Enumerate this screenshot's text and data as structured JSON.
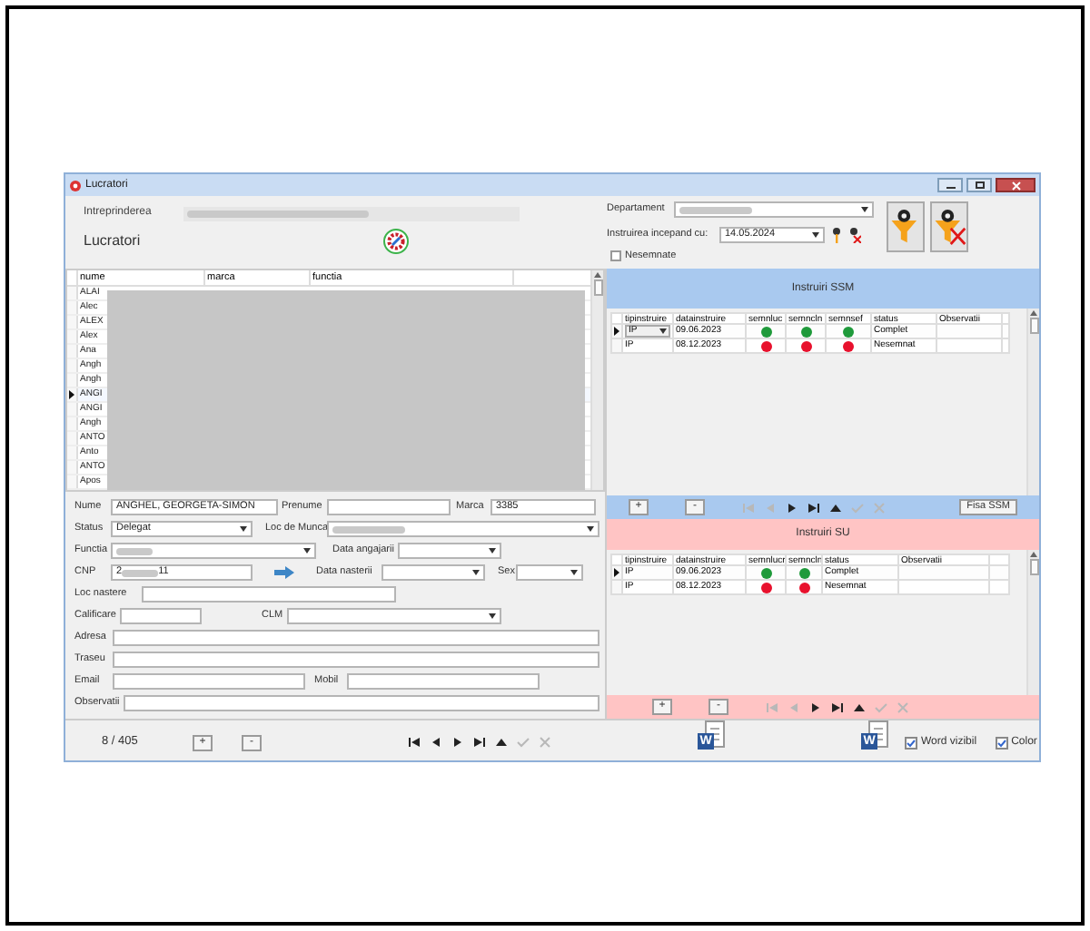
{
  "window": {
    "title": "Lucratori"
  },
  "header": {
    "intreprinderea_label": "Intreprinderea",
    "section_title": "Lucratori",
    "departament_label": "Departament",
    "instruirea_label": "Instruirea incepand cu:",
    "instruirea_value": "14.05.2024",
    "nesemnate": {
      "label": "Nesemnate",
      "checked": false
    }
  },
  "employees": {
    "columns": [
      "nume",
      "marca",
      "functia"
    ],
    "rows": [
      {
        "nume": "ALAI",
        "selected": false
      },
      {
        "nume": "Alec",
        "selected": false
      },
      {
        "nume": "ALEX",
        "selected": false
      },
      {
        "nume": "Alex",
        "selected": false
      },
      {
        "nume": "Ana",
        "selected": false
      },
      {
        "nume": "Angh",
        "selected": false
      },
      {
        "nume": "Angh",
        "selected": false
      },
      {
        "nume": "ANGI",
        "selected": true
      },
      {
        "nume": "ANGI",
        "selected": false
      },
      {
        "nume": "Angh",
        "selected": false
      },
      {
        "nume": "ANTO",
        "selected": false
      },
      {
        "nume": "Anto",
        "selected": false
      },
      {
        "nume": "ANTO",
        "selected": false
      },
      {
        "nume": "Apos",
        "selected": false
      }
    ]
  },
  "form": {
    "nume": {
      "label": "Nume",
      "value": "ANGHEL, GEORGETA-SIMON"
    },
    "prenume": {
      "label": "Prenume"
    },
    "marca": {
      "label": "Marca",
      "value": "3385"
    },
    "status": {
      "label": "Status",
      "value": "Delegat"
    },
    "loc_munca": {
      "label": "Loc de Munca"
    },
    "functia": {
      "label": "Functia"
    },
    "data_angajarii": {
      "label": "Data angajarii"
    },
    "cnp": {
      "label": "CNP",
      "value_start": "2",
      "value_end": "11"
    },
    "data_nasterii": {
      "label": "Data nasterii"
    },
    "sex": {
      "label": "Sex"
    },
    "loc_nastere": {
      "label": "Loc nastere"
    },
    "calificare": {
      "label": "Calificare"
    },
    "clm": {
      "label": "CLM"
    },
    "adresa": {
      "label": "Adresa"
    },
    "traseu": {
      "label": "Traseu"
    },
    "email": {
      "label": "Email"
    },
    "mobil": {
      "label": "Mobil"
    },
    "observatii": {
      "label": "Observatii"
    }
  },
  "ssm": {
    "title": "Instruiri SSM",
    "columns": [
      "tipinstruire",
      "datainstruire",
      "semnluc",
      "semncln",
      "semnsef",
      "status",
      "Observatii"
    ],
    "rows": [
      {
        "tipinstruire": "IP",
        "editing": true,
        "datainstruire": "09.06.2023",
        "marks": [
          {
            "color": "#1f9a3b"
          },
          {
            "color": "#1f9a3b"
          },
          {
            "color": "#1f9a3b"
          }
        ],
        "status": "Complet",
        "selected": true
      },
      {
        "tipinstruire": "IP",
        "editing": false,
        "datainstruire": "08.12.2023",
        "marks": [
          {
            "color": "#e8112d"
          },
          {
            "color": "#e8112d"
          },
          {
            "color": "#e8112d"
          }
        ],
        "status": "Nesemnat",
        "selected": false
      }
    ],
    "add_label": "+",
    "remove_label": "-",
    "nav": [
      {
        "kind": "first",
        "disabled": true
      },
      {
        "kind": "prev",
        "disabled": true
      },
      {
        "kind": "next",
        "disabled": false
      },
      {
        "kind": "last",
        "disabled": false
      },
      {
        "kind": "up",
        "disabled": false
      },
      {
        "kind": "post",
        "disabled": true
      },
      {
        "kind": "cancel",
        "disabled": true
      }
    ],
    "fisa_button": "Fisa SSM"
  },
  "su": {
    "title": "Instruiri SU",
    "columns": [
      "tipinstruire",
      "datainstruire",
      "semnlucr",
      "semncln",
      "status",
      "Observatii"
    ],
    "rows": [
      {
        "tipinstruire": "IP",
        "editing": false,
        "datainstruire": "09.06.2023",
        "marks": [
          {
            "color": "#1f9a3b"
          },
          {
            "color": "#1f9a3b"
          }
        ],
        "status": "Complet",
        "selected": true
      },
      {
        "tipinstruire": "IP",
        "editing": false,
        "datainstruire": "08.12.2023",
        "marks": [
          {
            "color": "#e8112d"
          },
          {
            "color": "#e8112d"
          }
        ],
        "status": "Nesemnat",
        "selected": false
      }
    ],
    "add_label": "+",
    "remove_label": "-",
    "nav": [
      {
        "kind": "first",
        "disabled": true
      },
      {
        "kind": "prev",
        "disabled": true
      },
      {
        "kind": "next",
        "disabled": false
      },
      {
        "kind": "last",
        "disabled": false
      },
      {
        "kind": "up",
        "disabled": false
      },
      {
        "kind": "post",
        "disabled": true
      },
      {
        "kind": "cancel",
        "disabled": true
      }
    ]
  },
  "footer": {
    "counter": "8 / 405",
    "add_label": "+",
    "remove_label": "-",
    "nav": [
      {
        "kind": "first",
        "disabled": false
      },
      {
        "kind": "prev",
        "disabled": false
      },
      {
        "kind": "next",
        "disabled": false
      },
      {
        "kind": "last",
        "disabled": false
      },
      {
        "kind": "up",
        "disabled": false
      },
      {
        "kind": "post",
        "disabled": true
      },
      {
        "kind": "cancel",
        "disabled": true
      }
    ],
    "word_buttons": [
      {
        "letter": "W"
      },
      {
        "letter": "W"
      }
    ],
    "word_vizibil": {
      "label": "Word vizibil",
      "checked": true
    },
    "color": {
      "label": "Color",
      "checked": true
    }
  }
}
